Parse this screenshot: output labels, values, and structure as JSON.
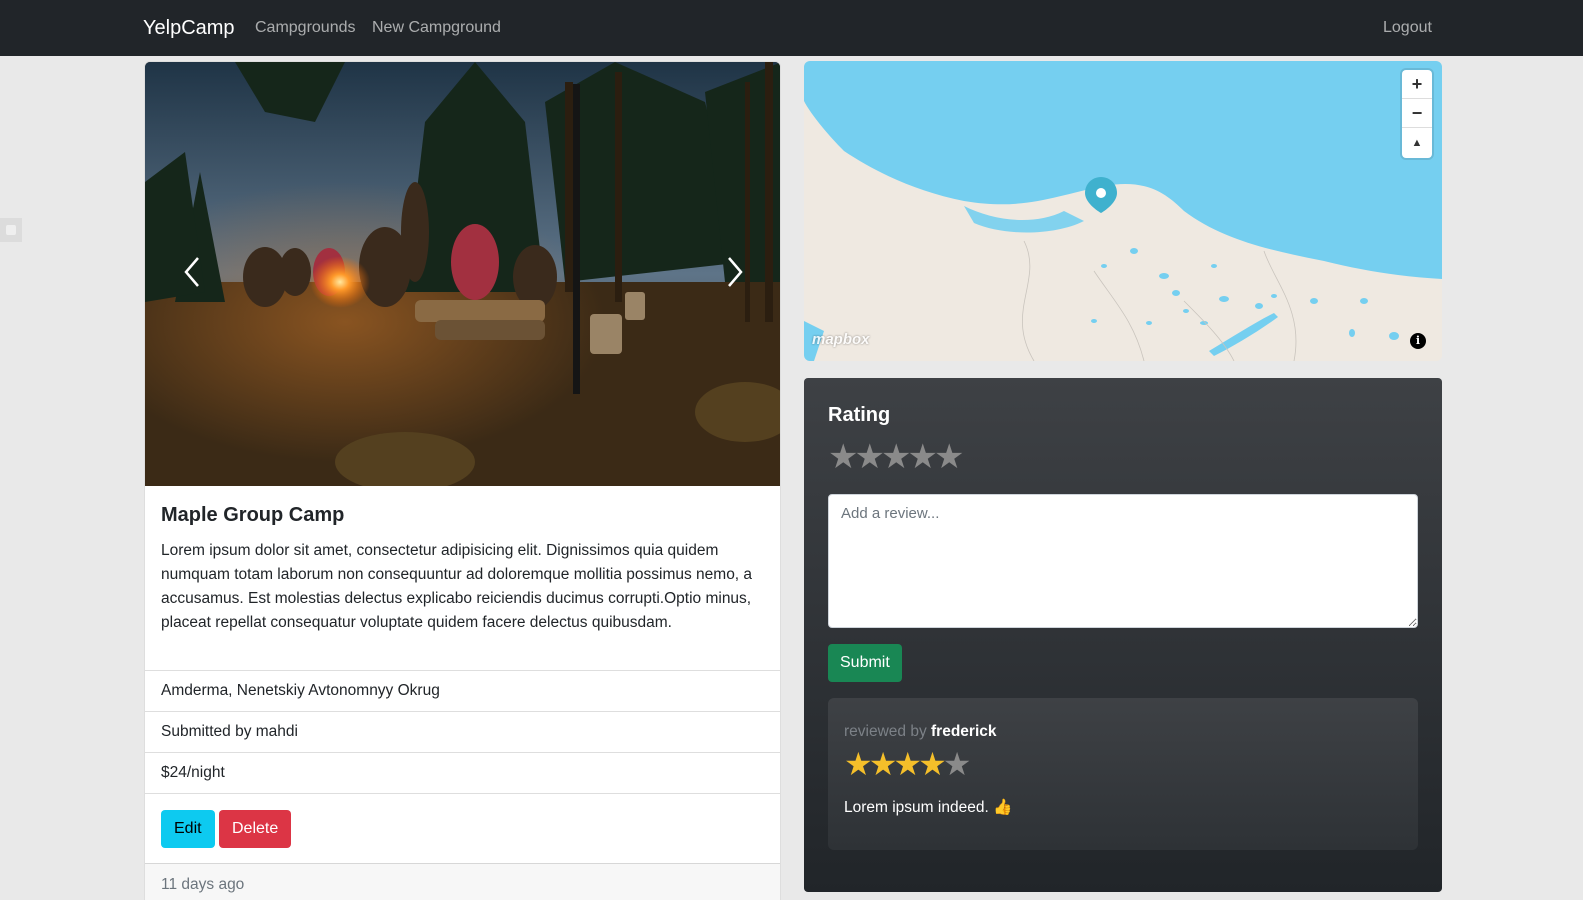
{
  "navbar": {
    "brand": "YelpCamp",
    "links": [
      "Campgrounds",
      "New Campground"
    ],
    "logout": "Logout"
  },
  "campground": {
    "title": "Maple Group Camp",
    "description": "Lorem ipsum dolor sit amet, consectetur adipisicing elit. Dignissimos quia quidem numquam totam laborum non consequuntur ad doloremque mollitia possimus nemo, a accusamus. Est molestias delectus explicabo reiciendis ducimus corrupti.Optio minus, placeat repellat consequatur voluptate quidem facere delectus quibusdam.",
    "location": "Amderma, Nenetskiy Avtonomnyy Okrug",
    "submitted_by": "Submitted by mahdi",
    "price": "$24/night",
    "edit_label": "Edit",
    "delete_label": "Delete",
    "time_ago": "11 days ago"
  },
  "map": {
    "attribution": "mapbox",
    "zoom_in": "+",
    "zoom_out": "−",
    "compass": "▲",
    "info": "i",
    "colors": {
      "water": "#75cff0",
      "land": "#efe9e1",
      "marker": "#3fb1ce"
    }
  },
  "review_form": {
    "title": "Rating",
    "rating_max": 5,
    "rating_value": 0,
    "placeholder": "Add a review...",
    "submit_label": "Submit"
  },
  "reviews": [
    {
      "prefix": "reviewed by ",
      "author": "frederick",
      "rating": 4,
      "rating_max": 5,
      "text": "Lorem ipsum indeed. 👍"
    }
  ],
  "colors": {
    "star_filled": "#f5bf2a",
    "star_empty": "#8a8a8a",
    "edit": "#0dcaf0",
    "delete": "#dc3545",
    "submit": "#198754"
  }
}
